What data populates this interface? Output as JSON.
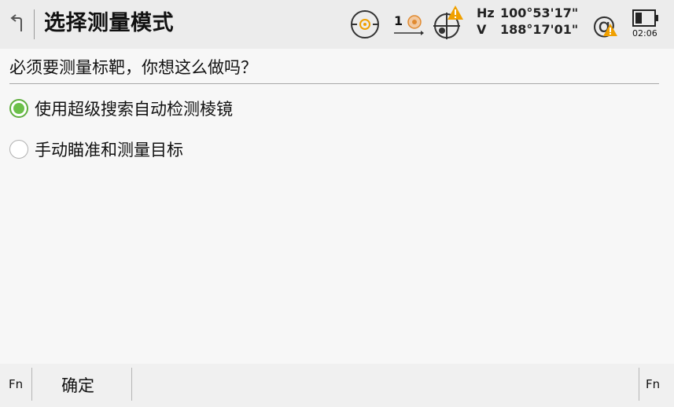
{
  "header": {
    "title": "选择测量模式",
    "prism_count": "1",
    "hz_label": "Hz",
    "hz_value": "100°53'17\"",
    "v_label": "V",
    "v_value": "188°17'01\"",
    "time": "02:06",
    "warning_color": "#f0a000"
  },
  "question": "必须要测量标靶，你想这么做吗？",
  "options": [
    {
      "label": "使用超级搜索自动检测棱镜",
      "selected": true
    },
    {
      "label": "手动瞄准和测量目标",
      "selected": false
    }
  ],
  "footer": {
    "fn_left": "Fn",
    "ok": "确定",
    "fn_right": "Fn"
  }
}
